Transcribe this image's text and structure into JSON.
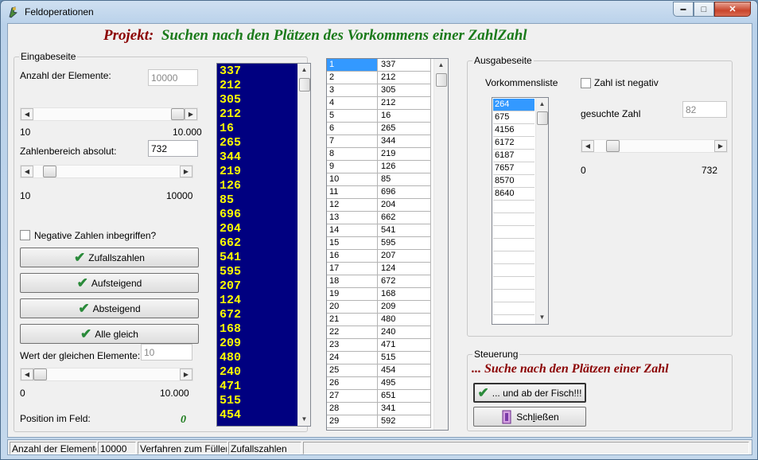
{
  "window": {
    "title": "Feldoperationen",
    "controls": {
      "minimize": "▬",
      "maximize": "□",
      "close": "✕"
    }
  },
  "heading": {
    "prefix": "Projekt:",
    "text": "Suchen nach den Plätzen des Vorkommens einer ZahlZahl",
    "prefix_color": "#8b0000",
    "text_color": "#1a7a1a"
  },
  "input": {
    "group_label": "Eingabeseite",
    "count_label": "Anzahl der Elemente:",
    "count_value": "10000",
    "count_slider": {
      "min_label": "10",
      "max_label": "10.000",
      "level": 1.0
    },
    "range_label": "Zahlenbereich absolut:",
    "range_value": "732",
    "range_slider": {
      "min_label": "10",
      "max_label": "10000",
      "level": 0.07
    },
    "negative_label": "Negative Zahlen inbegriffen?",
    "buttons": [
      "Zufallszahlen",
      "Aufsteigend",
      "Absteigend",
      "Alle gleich"
    ],
    "equal_label": "Wert der gleichen Elemente:",
    "equal_value": "10",
    "equal_slider": {
      "min_label": "0",
      "max_label": "10.000",
      "level": 0.0
    },
    "position_label": "Position im Feld:",
    "position_value": "0"
  },
  "memo_values": [
    "337",
    "212",
    "305",
    "212",
    "16",
    "265",
    "344",
    "219",
    "126",
    "85",
    "696",
    "204",
    "662",
    "541",
    "595",
    "207",
    "124",
    "672",
    "168",
    "209",
    "480",
    "240",
    "471",
    "515",
    "454"
  ],
  "grid_rows": [
    [
      "1",
      "337"
    ],
    [
      "2",
      "212"
    ],
    [
      "3",
      "305"
    ],
    [
      "4",
      "212"
    ],
    [
      "5",
      "16"
    ],
    [
      "6",
      "265"
    ],
    [
      "7",
      "344"
    ],
    [
      "8",
      "219"
    ],
    [
      "9",
      "126"
    ],
    [
      "10",
      "85"
    ],
    [
      "11",
      "696"
    ],
    [
      "12",
      "204"
    ],
    [
      "13",
      "662"
    ],
    [
      "14",
      "541"
    ],
    [
      "15",
      "595"
    ],
    [
      "16",
      "207"
    ],
    [
      "17",
      "124"
    ],
    [
      "18",
      "672"
    ],
    [
      "19",
      "168"
    ],
    [
      "20",
      "209"
    ],
    [
      "21",
      "480"
    ],
    [
      "22",
      "240"
    ],
    [
      "23",
      "471"
    ],
    [
      "24",
      "515"
    ],
    [
      "25",
      "454"
    ],
    [
      "26",
      "495"
    ],
    [
      "27",
      "651"
    ],
    [
      "28",
      "341"
    ],
    [
      "29",
      "592"
    ]
  ],
  "output": {
    "group_label": "Ausgabeseite",
    "list_label": "Vorkommensliste",
    "list_items": [
      "264",
      "675",
      "4156",
      "6172",
      "6187",
      "7657",
      "8570",
      "8640"
    ],
    "negative_label": "Zahl ist negativ",
    "search_label": "gesuchte Zahl",
    "search_value": "82",
    "search_slider": {
      "min_label": "0",
      "max_label": "732",
      "level": 0.11
    }
  },
  "control": {
    "group_label": "Steuerung",
    "caption": "... Suche nach den Plätzen einer Zahl",
    "caption_color": "#8b0000",
    "run_button": "... und ab der Fisch!!!",
    "close_button_prefix": "Sch",
    "close_button_underline": "l",
    "close_button_suffix": "ießen"
  },
  "statusbar": {
    "count_label": "Anzahl der Elemente",
    "count_value": "10000",
    "method_label": "Verfahren zum Füller",
    "method_value": "Zufallszahlen"
  }
}
